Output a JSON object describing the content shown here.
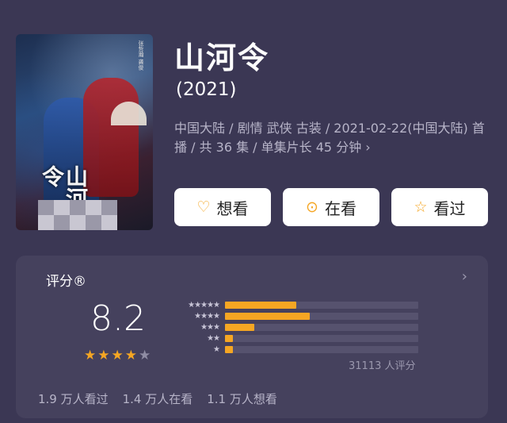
{
  "poster": {
    "calligraphy": "山河令",
    "seal_text": "张哲瀚 龚俊"
  },
  "title": "山河令",
  "year": "(2021)",
  "meta": "中国大陆 / 剧情 武侠 古装 / 2021-02-22(中国大陆) 首播 / 共 36 集 / 单集片长 45 分钟",
  "meta_chevron": "›",
  "actions": [
    {
      "label": "想看",
      "icon": "heart-plus-icon",
      "glyph": "♡"
    },
    {
      "label": "在看",
      "icon": "target-icon",
      "glyph": "⊙"
    },
    {
      "label": "看过",
      "icon": "star-outline-icon",
      "glyph": "☆"
    }
  ],
  "rating": {
    "label": "评分®",
    "chevron": "›",
    "score": "8.2",
    "stars_filled": 4,
    "stars_total": 5,
    "star_glyph": "★",
    "distribution": [
      {
        "stars": "★★★★★",
        "fraction": 0.37
      },
      {
        "stars": "★★★★",
        "fraction": 0.44
      },
      {
        "stars": "★★★",
        "fraction": 0.15
      },
      {
        "stars": "★★",
        "fraction": 0.04
      },
      {
        "stars": "★",
        "fraction": 0.04
      }
    ],
    "raters": "31113 人评分"
  },
  "stats": [
    "1.9 万人看过",
    "1.4 万人在看",
    "1.1 万人想看"
  ],
  "colors": {
    "background": "#3b3754",
    "panel": "#45415d",
    "accent": "#f5a623",
    "muted_text": "#b7b4c8"
  }
}
